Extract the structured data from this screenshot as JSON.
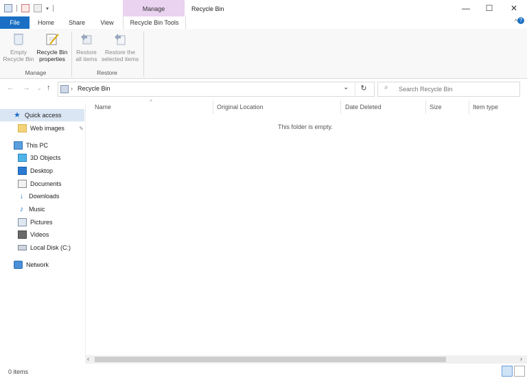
{
  "window": {
    "title": "Recycle Bin",
    "context_tab_group": "Manage",
    "minimize": "—",
    "maximize": "☐",
    "close": "✕"
  },
  "ribbon_tabs": {
    "file": "File",
    "home": "Home",
    "share": "Share",
    "view": "View",
    "recycle_bin_tools": "Recycle Bin Tools"
  },
  "help_chevron": "^",
  "ribbon": {
    "manage_group": {
      "label": "Manage",
      "empty_line1": "Empty",
      "empty_line2": "Recycle Bin",
      "props_line1": "Recycle Bin",
      "props_line2": "properties"
    },
    "restore_group": {
      "label": "Restore",
      "restore_all_line1": "Restore",
      "restore_all_line2": "all items",
      "restore_sel_line1": "Restore the",
      "restore_sel_line2": "selected items"
    }
  },
  "address": {
    "path": "Recycle Bin",
    "search_placeholder": "Search Recycle Bin"
  },
  "nav": {
    "quick_access": "Quick access",
    "web_images": "Web images",
    "this_pc": "This PC",
    "objects3d": "3D Objects",
    "desktop": "Desktop",
    "documents": "Documents",
    "downloads": "Downloads",
    "music": "Music",
    "pictures": "Pictures",
    "videos": "Videos",
    "local_disk": "Local Disk (C:)",
    "network": "Network"
  },
  "columns": {
    "name": "Name",
    "original_location": "Original Location",
    "date_deleted": "Date Deleted",
    "size": "Size",
    "item_type": "Item type"
  },
  "empty_message": "This folder is empty.",
  "status": {
    "items": "0 items"
  },
  "colors": {
    "accent": "#1a6fc4",
    "context_tab": "#e9d3f0",
    "selection": "#dbe6f4"
  }
}
